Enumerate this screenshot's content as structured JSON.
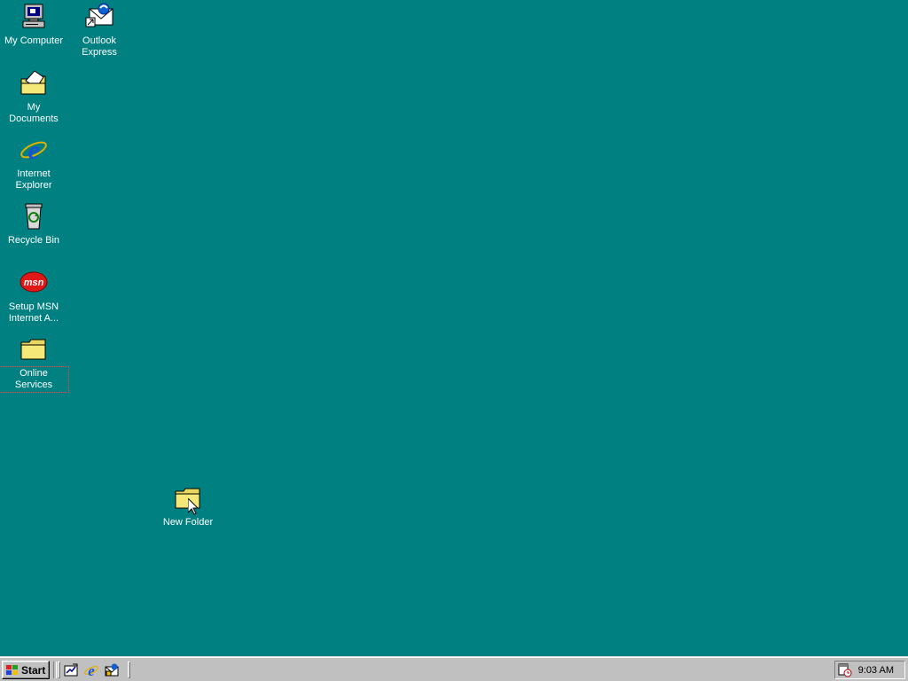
{
  "desktop": {
    "background_color": "#008080",
    "icons": [
      {
        "label": "My Computer",
        "icon": "my-computer-icon"
      },
      {
        "label": "Outlook Express",
        "icon": "outlook-express-icon"
      },
      {
        "label": "My Documents",
        "icon": "my-documents-icon"
      },
      {
        "label": "Internet Explorer",
        "icon": "internet-explorer-icon"
      },
      {
        "label": "Recycle Bin",
        "icon": "recycle-bin-icon"
      },
      {
        "label": "Setup MSN Internet A...",
        "icon": "msn-icon"
      },
      {
        "label": "Online Services",
        "icon": "folder-icon",
        "focused": true
      },
      {
        "label": "New Folder",
        "icon": "folder-icon"
      }
    ]
  },
  "taskbar": {
    "start_label": "Start",
    "quick_launch": [
      "show-desktop-icon",
      "internet-explorer-icon",
      "outlook-express-icon"
    ],
    "tray": {
      "icon": "scheduler-icon",
      "clock": "9:03 AM"
    }
  }
}
